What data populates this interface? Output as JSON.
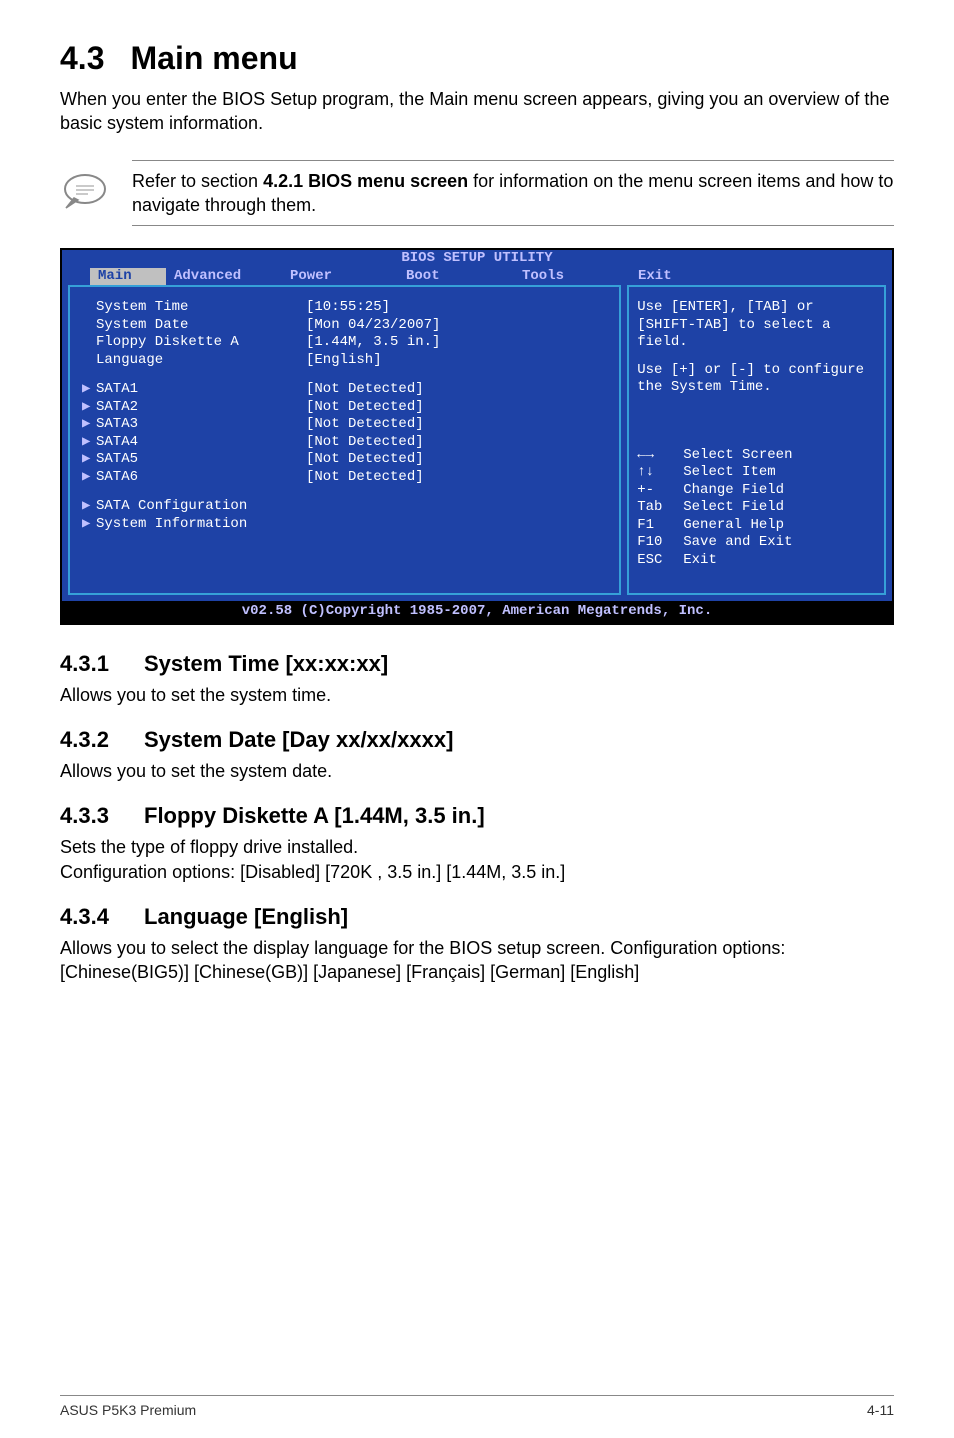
{
  "section": {
    "number": "4.3",
    "title": "Main menu",
    "intro": "When you enter the BIOS Setup program, the Main menu screen appears, giving you an overview of the basic system information."
  },
  "note": {
    "prefix": "Refer to section ",
    "bold": "4.2.1  BIOS menu screen",
    "suffix": " for information on the menu screen items and how to navigate through them."
  },
  "bios": {
    "title": "BIOS SETUP UTILITY",
    "tabs": [
      "Main",
      "Advanced",
      "Power",
      "Boot",
      "Tools",
      "Exit"
    ],
    "selected_tab": "Main",
    "left_rows_top": [
      {
        "label": "System Time",
        "value": "[10:55:25]"
      },
      {
        "label": "System Date",
        "value": "[Mon 04/23/2007]"
      },
      {
        "label": "Floppy Diskette A",
        "value": "[1.44M, 3.5 in.]"
      },
      {
        "label": "Language",
        "value": "[English]"
      }
    ],
    "left_rows_sata": [
      {
        "label": "SATA1",
        "value": "[Not Detected]"
      },
      {
        "label": "SATA2",
        "value": "[Not Detected]"
      },
      {
        "label": "SATA3",
        "value": "[Not Detected]"
      },
      {
        "label": "SATA4",
        "value": "[Not Detected]"
      },
      {
        "label": "SATA5",
        "value": "[Not Detected]"
      },
      {
        "label": "SATA6",
        "value": "[Not Detected]"
      }
    ],
    "left_rows_bottom": [
      {
        "label": "SATA Configuration"
      },
      {
        "label": "System Information"
      }
    ],
    "right_help1": "Use [ENTER], [TAB] or [SHIFT-TAB] to select a field.",
    "right_help2": "Use [+] or [-] to configure the System Time.",
    "right_hints": [
      {
        "key": "←→",
        "desc": "Select Screen"
      },
      {
        "key": "↑↓",
        "desc": "Select Item"
      },
      {
        "key": "+-",
        "desc": "Change Field"
      },
      {
        "key": "Tab",
        "desc": "Select Field"
      },
      {
        "key": "F1",
        "desc": "General Help"
      },
      {
        "key": "F10",
        "desc": "Save and Exit"
      },
      {
        "key": "ESC",
        "desc": "Exit"
      }
    ],
    "footer": "v02.58 (C)Copyright 1985-2007, American Megatrends, Inc."
  },
  "subsections": [
    {
      "num": "4.3.1",
      "title": "System Time [xx:xx:xx]",
      "body": "Allows you to set the system time."
    },
    {
      "num": "4.3.2",
      "title": "System Date [Day xx/xx/xxxx]",
      "body": "Allows you to set the system date."
    },
    {
      "num": "4.3.3",
      "title": "Floppy Diskette A [1.44M, 3.5 in.]",
      "body": "Sets the type of floppy drive installed.\nConfiguration options: [Disabled] [720K , 3.5 in.] [1.44M, 3.5 in.]"
    },
    {
      "num": "4.3.4",
      "title": "Language [English]",
      "body": "Allows you to select the display language for the BIOS setup screen. Configuration options: [Chinese(BIG5)] [Chinese(GB)] [Japanese] [Français] [German] [English]"
    }
  ],
  "footer": {
    "left": "ASUS P5K3 Premium",
    "right": "4-11"
  }
}
